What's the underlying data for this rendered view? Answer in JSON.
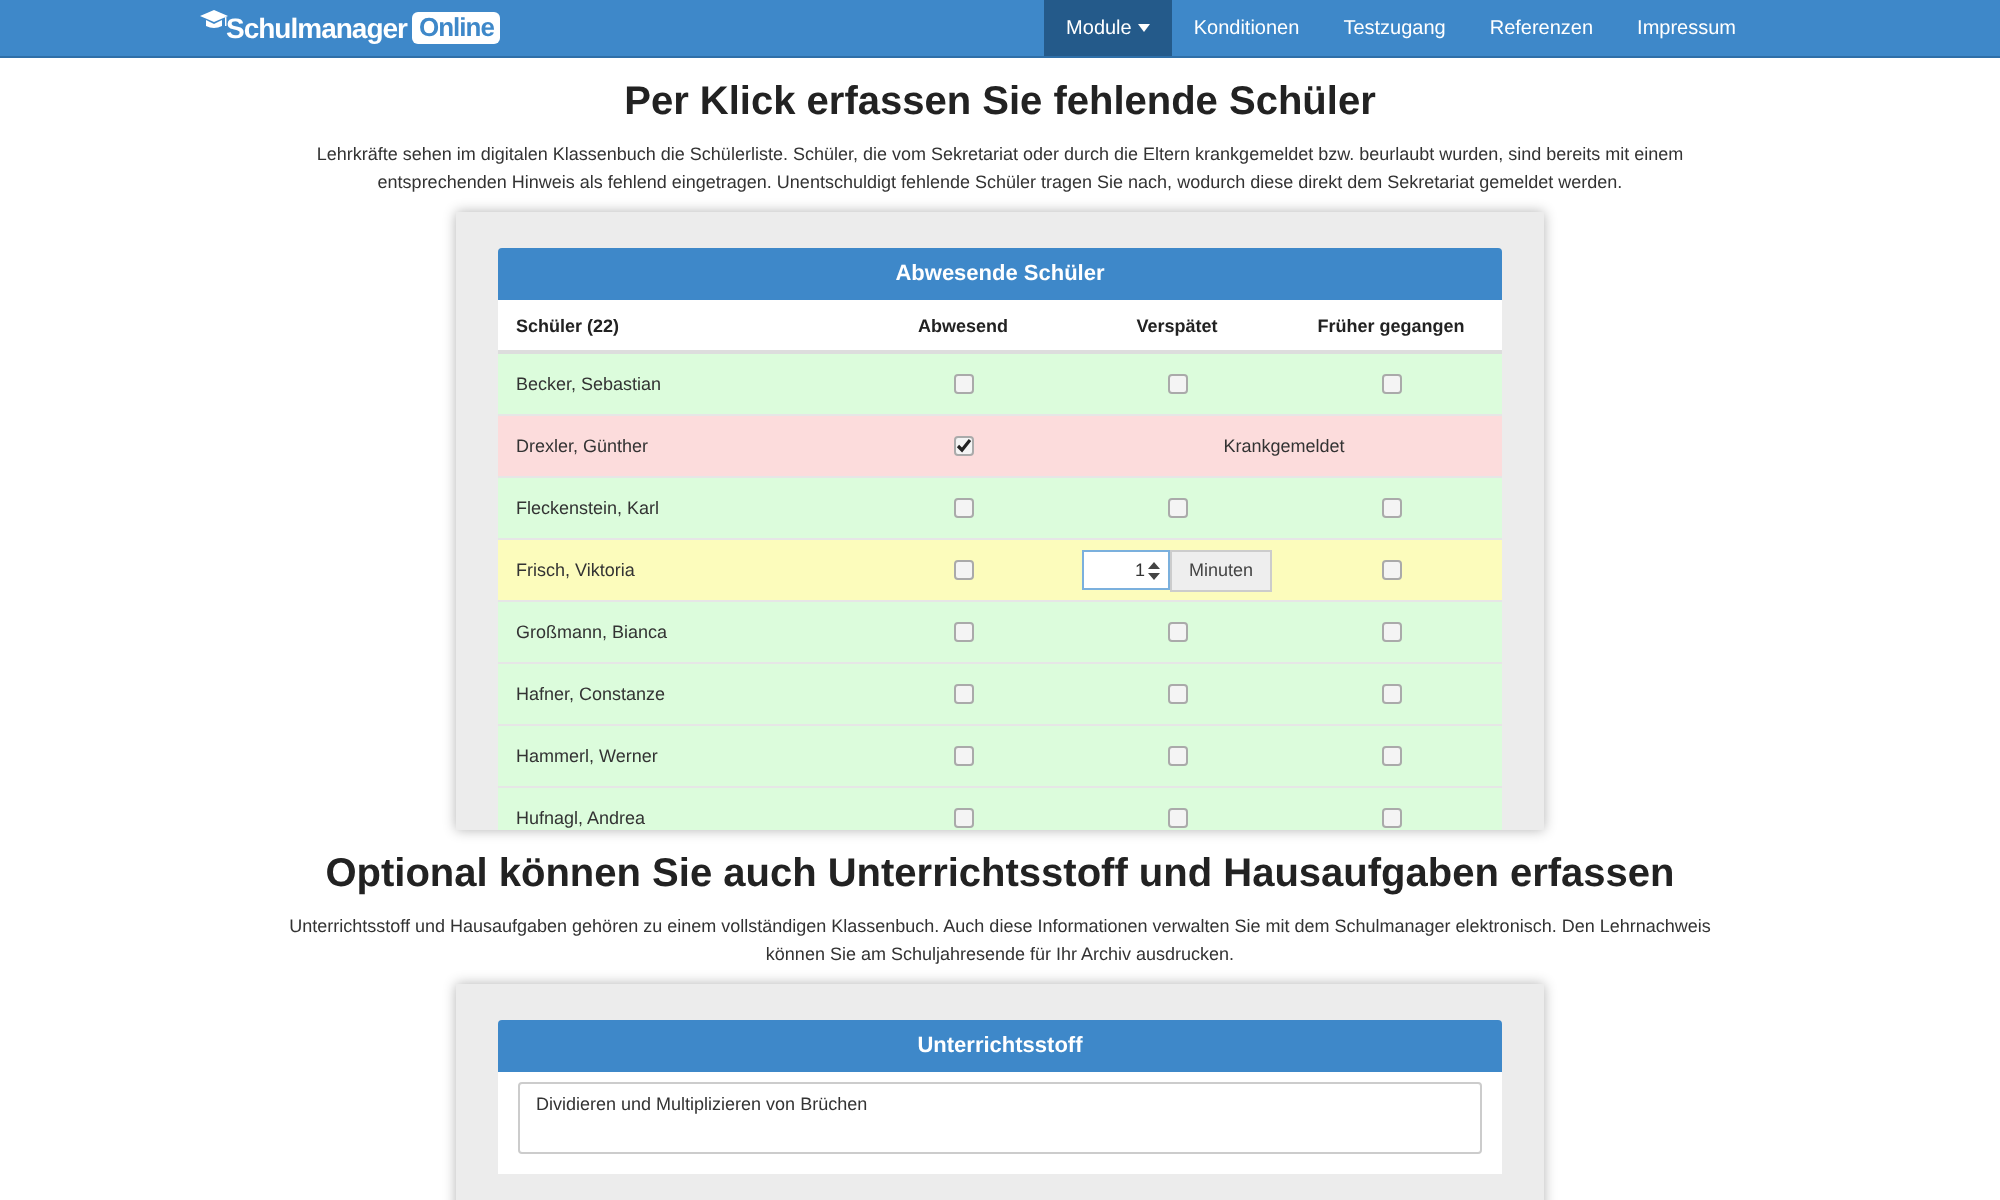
{
  "navbar": {
    "logo_text": "Schulmanager",
    "logo_badge": "Online",
    "items": [
      {
        "label": "Module",
        "selected": true,
        "dropdown": true
      },
      {
        "label": "Konditionen",
        "selected": false,
        "dropdown": false
      },
      {
        "label": "Testzugang",
        "selected": false,
        "dropdown": false
      },
      {
        "label": "Referenzen",
        "selected": false,
        "dropdown": false
      },
      {
        "label": "Impressum",
        "selected": false,
        "dropdown": false
      }
    ]
  },
  "sections": [
    {
      "heading": "Per Klick erfassen Sie fehlende Schüler",
      "text": "Lehrkräfte sehen im digitalen Klassenbuch die Schülerliste. Schüler, die vom Sekretariat oder durch die Eltern krankgemeldet bzw. beurlaubt wurden, sind bereits mit einem entsprechenden Hinweis als fehlend eingetragen. Unentschuldigt fehlende Schüler tragen Sie nach, wodurch diese direkt dem Sekretariat gemeldet werden.",
      "panel": {
        "kind": "table",
        "title": "Abwesende Schüler",
        "columns": [
          "Schüler (22)",
          "Abwesend",
          "Verspätet",
          "Früher gegangen"
        ],
        "rows": [
          {
            "name": "Becker, Sebastian",
            "color": "#dcfcdc",
            "kind": "checks",
            "absent": false,
            "late": false,
            "left_early": false
          },
          {
            "name": "Drexler, Günther",
            "color": "#fcdcdc",
            "kind": "note",
            "absent": true,
            "note": "Krankgemeldet"
          },
          {
            "name": "Fleckenstein, Karl",
            "color": "#dcfcdc",
            "kind": "checks",
            "absent": false,
            "late": false,
            "left_early": false
          },
          {
            "name": "Frisch, Viktoria",
            "color": "#fcfcbc",
            "kind": "minutes",
            "absent": false,
            "minutes": "1",
            "unit": "Minuten",
            "left_early": false
          },
          {
            "name": "Großmann, Bianca",
            "color": "#dcfcdc",
            "kind": "checks",
            "absent": false,
            "late": false,
            "left_early": false
          },
          {
            "name": "Hafner, Constanze",
            "color": "#dcfcdc",
            "kind": "checks",
            "absent": false,
            "late": false,
            "left_early": false
          },
          {
            "name": "Hammerl, Werner",
            "color": "#dcfcdc",
            "kind": "checks",
            "absent": false,
            "late": false,
            "left_early": false
          },
          {
            "name": "Hufnagl, Andrea",
            "color": "#dcfcdc",
            "kind": "checks",
            "absent": false,
            "late": false,
            "left_early": false
          }
        ]
      }
    },
    {
      "heading": "Optional können Sie auch Unterrichtsstoff und Hausaufgaben erfassen",
      "text": "Unterrichtsstoff und Hausaufgaben gehören zu einem vollständigen Klassenbuch. Auch diese Informationen verwalten Sie mit dem Schulmanager elektronisch. Den Lehrnachweis können Sie am Schuljahresende für Ihr Archiv ausdrucken.",
      "panel": {
        "kind": "textarea",
        "title": "Unterrichtsstoff",
        "value": "Dividieren und Multiplizieren von Brüchen"
      }
    }
  ]
}
